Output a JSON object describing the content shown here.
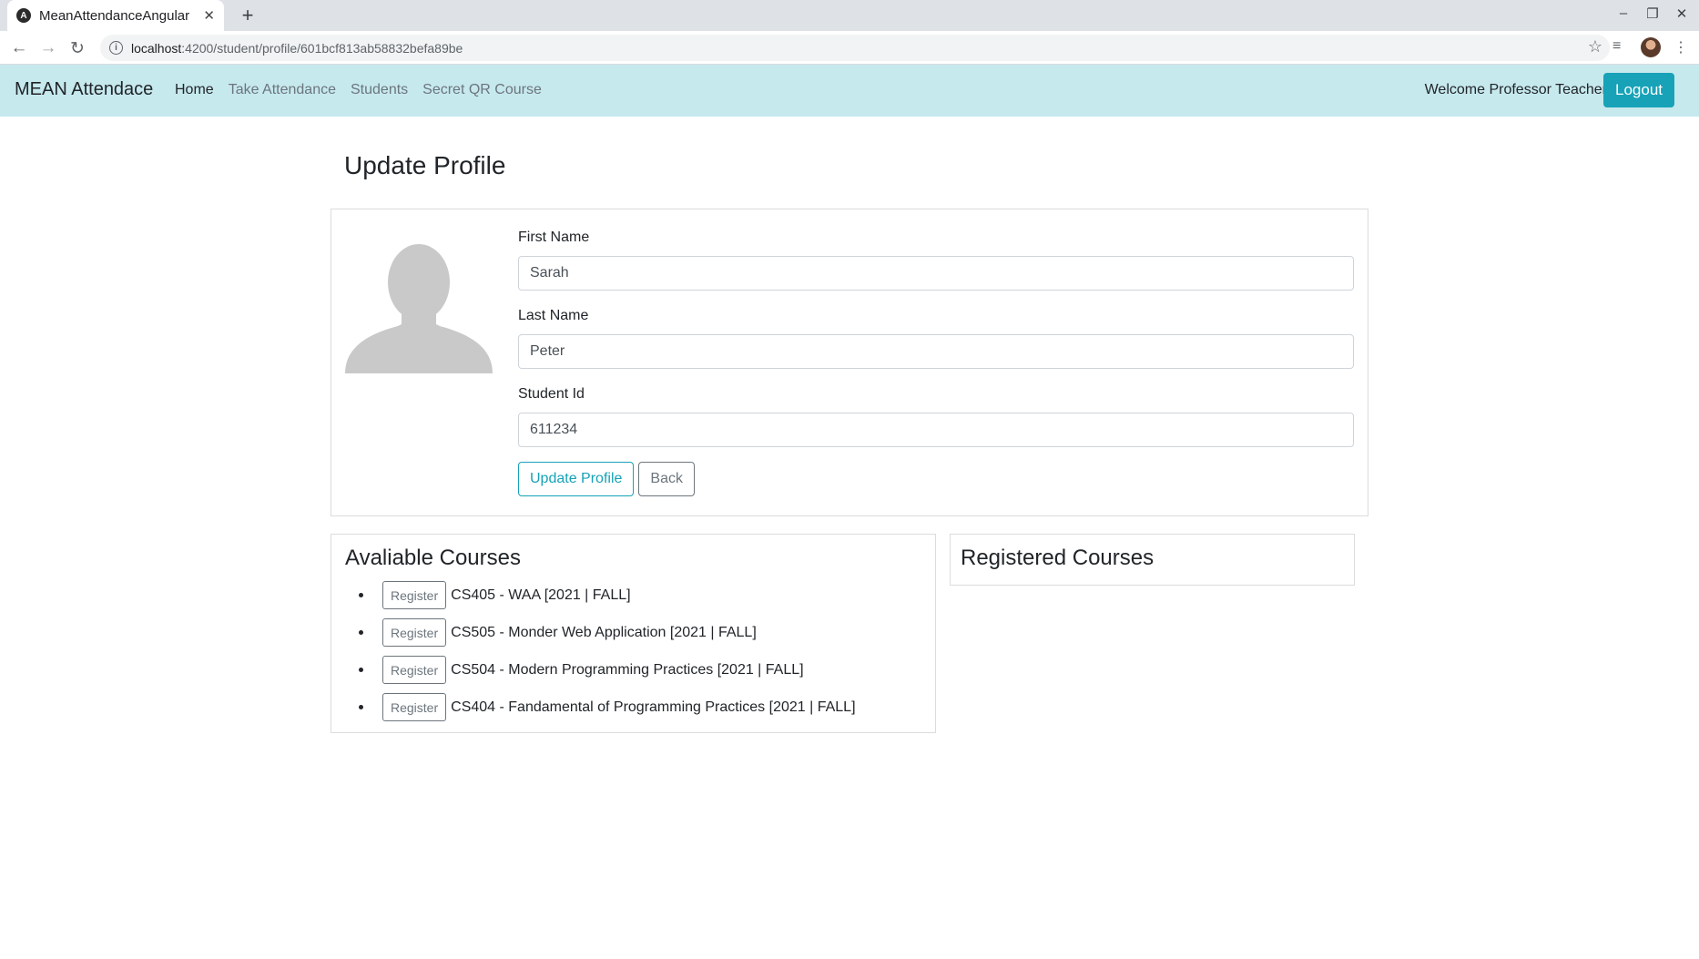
{
  "browser": {
    "tab_title": "MeanAttendanceAngular",
    "url_host": "localhost",
    "url_path": ":4200/student/profile/601bcf813ab58832befa89be"
  },
  "navbar": {
    "brand": "MEAN Attendace",
    "links": [
      "Home",
      "Take Attendance",
      "Students",
      "Secret QR Course"
    ],
    "active_link": "Home",
    "welcome": "Welcome Professor Teacher",
    "logout_label": "Logout",
    "accent_color": "#17a2b8",
    "bg_color": "#c6e9ee"
  },
  "page": {
    "title": "Update Profile"
  },
  "profile_form": {
    "first_name_label": "First Name",
    "first_name_value": "Sarah",
    "last_name_label": "Last Name",
    "last_name_value": "Peter",
    "student_id_label": "Student Id",
    "student_id_value": "611234",
    "update_button": "Update Profile",
    "back_button": "Back"
  },
  "available_courses": {
    "title": "Avaliable Courses",
    "register_label": "Register",
    "items": [
      "CS405 - WAA [2021 | FALL]",
      "CS505 - Monder Web Application [2021 | FALL]",
      "CS504 - Modern Programming Practices [2021 | FALL]",
      "CS404 - Fandamental of Programming Practices [2021 | FALL]"
    ]
  },
  "registered_courses": {
    "title": "Registered Courses"
  }
}
